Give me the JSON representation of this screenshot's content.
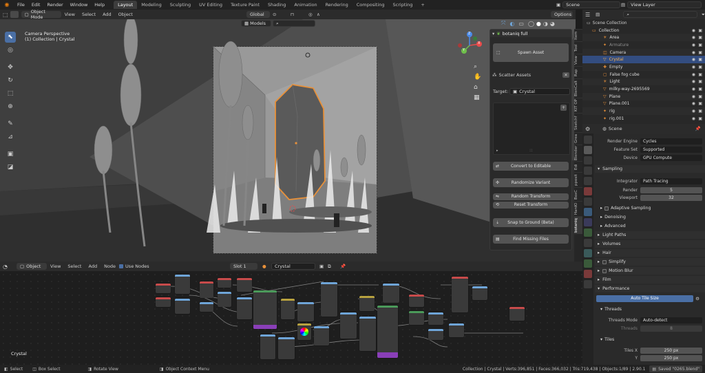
{
  "menu": [
    "File",
    "Edit",
    "Render",
    "Window",
    "Help"
  ],
  "workspaces": [
    "Layout",
    "Modeling",
    "Sculpting",
    "UV Editing",
    "Texture Paint",
    "Shading",
    "Animation",
    "Rendering",
    "Compositing",
    "Scripting"
  ],
  "active_workspace": "Layout",
  "scene_field": "Scene",
  "view_layer_field": "View Layer",
  "viewport": {
    "mode": "Object Mode",
    "menus": [
      "View",
      "Select",
      "Add",
      "Object"
    ],
    "transform_orientation": "Global",
    "options_label": "Options",
    "overlay_text_1": "Camera Perspective",
    "overlay_text_2": "(1) Collection | Crystal",
    "models_dropdown": "Models",
    "gizmo_axes": [
      "X",
      "Y",
      "Z"
    ]
  },
  "addon": {
    "title": "botaniq full",
    "spawn_asset": "Spawn Asset",
    "scatter_assets": "Scatter Assets",
    "target_label": "Target:",
    "target_value": "Crystal",
    "convert_editable": "Convert to Editable",
    "randomize_variant": "Randomize Variant",
    "random_transform": "Random Transform",
    "reset_transform": "Reset Transform",
    "snap_to_ground": "Snap to Ground (Beta)",
    "find_missing": "Find Missing Files"
  },
  "n_tabs": [
    "Item",
    "Tool",
    "View",
    "Rap",
    "BlenCalt",
    "KIT OP",
    "Sketchf",
    "Grea",
    "Blender",
    "Edi",
    "pposit",
    "BoxC",
    "HardO",
    "botaniq"
  ],
  "node_editor": {
    "type": "Object",
    "menus": [
      "View",
      "Select",
      "Add",
      "Node"
    ],
    "use_nodes_label": "Use Nodes",
    "slot": "Slot 1",
    "material": "Crystal",
    "corner_label": "Crystal"
  },
  "outliner": {
    "root": "Scene Collection",
    "items": [
      {
        "name": "Collection",
        "color": "#dcdcdc"
      },
      {
        "name": "Area",
        "color": "#dcdcdc"
      },
      {
        "name": "Armature",
        "color": "#8e8e8e"
      },
      {
        "name": "Camera",
        "color": "#dcdcdc"
      },
      {
        "name": "Crystal",
        "color": "#ffb44a"
      },
      {
        "name": "Empty",
        "color": "#dcdcdc"
      },
      {
        "name": "False fog cube",
        "color": "#dcdcdc"
      },
      {
        "name": "Light",
        "color": "#dcdcdc"
      },
      {
        "name": "milky-way-2695569",
        "color": "#dcdcdc"
      },
      {
        "name": "Plane",
        "color": "#dcdcdc"
      },
      {
        "name": "Plane.001",
        "color": "#dcdcdc"
      },
      {
        "name": "rig",
        "color": "#dcdcdc"
      },
      {
        "name": "rig.001",
        "color": "#dcdcdc"
      }
    ],
    "selected_index": 4
  },
  "properties": {
    "context": "Scene",
    "render_engine_label": "Render Engine",
    "render_engine": "Cycles",
    "feature_set_label": "Feature Set",
    "feature_set": "Supported",
    "device_label": "Device",
    "device": "GPU Compute",
    "sampling": "Sampling",
    "integrator_label": "Integrator",
    "integrator": "Path Tracing",
    "render_label": "Render",
    "render_samples": "5",
    "viewport_label": "Viewport",
    "viewport_samples": "32",
    "adaptive_sampling": "Adaptive Sampling",
    "denoising": "Denoising",
    "advanced": "Advanced",
    "light_paths": "Light Paths",
    "volumes": "Volumes",
    "hair": "Hair",
    "simplify": "Simplify",
    "motion_blur": "Motion Blur",
    "film": "Film",
    "performance": "Performance",
    "auto_tile_size": "Auto Tile Size",
    "threads": "Threads",
    "threads_mode_label": "Threads Mode",
    "threads_mode": "Auto-detect",
    "threads_count_label": "Threads",
    "threads_count": "8",
    "tiles": "Tiles",
    "tiles_x_label": "Tiles X",
    "tiles_x": "250 px",
    "tiles_y_label": "Y",
    "tiles_y": "250 px"
  },
  "status": {
    "select": "Select",
    "box_select": "Box Select",
    "rotate_view": "Rotate View",
    "context_menu": "Object Context Menu",
    "stats": "Collection | Crystal | Verts:396,851 | Faces:366,032 | Tris:719,438 | Objects:1/89 | 2.90.1",
    "saved": "Saved \"0265.blend\""
  },
  "colors": {
    "accent": "#4a6fa5",
    "selection": "#334d80",
    "active_object_outline": "#e8913a",
    "node_header_blue": "#6fa5d8",
    "node_header_red": "#c84b4b",
    "node_header_purple": "#8a3fb8",
    "node_header_green": "#4b9a5a",
    "node_header_yellow": "#b8a23f"
  }
}
